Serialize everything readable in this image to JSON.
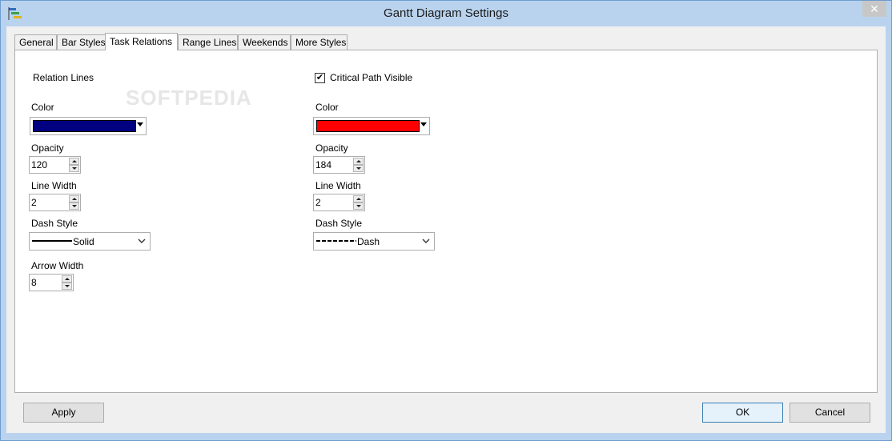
{
  "window": {
    "title": "Gantt Diagram Settings",
    "close_glyph": "✕",
    "app_icon": "gantt-chart-icon"
  },
  "watermark": "SOFTPEDIA",
  "tabs": [
    {
      "label": "General"
    },
    {
      "label": "Bar Styles"
    },
    {
      "label": "Task Relations",
      "active": true
    },
    {
      "label": "Range Lines"
    },
    {
      "label": "Weekends"
    },
    {
      "label": "More Styles"
    }
  ],
  "relation": {
    "heading": "Relation Lines",
    "color_label": "Color",
    "color_value": "#000080",
    "opacity_label": "Opacity",
    "opacity_value": "120",
    "line_width_label": "Line Width",
    "line_width_value": "2",
    "dash_style_label": "Dash Style",
    "dash_style_value": "Solid",
    "arrow_width_label": "Arrow Width",
    "arrow_width_value": "8"
  },
  "critical": {
    "checkbox_label": "Critical Path Visible",
    "checked": true,
    "check_glyph": "✔",
    "color_label": "Color",
    "color_value": "#ff0000",
    "opacity_label": "Opacity",
    "opacity_value": "184",
    "line_width_label": "Line Width",
    "line_width_value": "2",
    "dash_style_label": "Dash Style",
    "dash_style_value": "Dash"
  },
  "buttons": {
    "apply": "Apply",
    "ok": "OK",
    "cancel": "Cancel"
  }
}
